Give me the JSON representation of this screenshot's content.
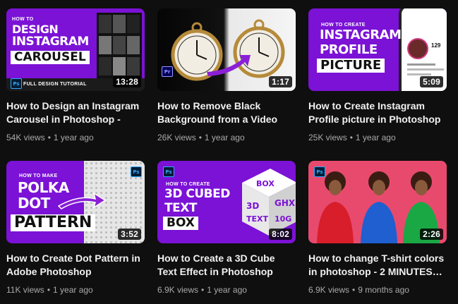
{
  "videos": [
    {
      "title": "How to Design an Instagram Carousel in Photoshop - Full…",
      "views": "54K views",
      "age": "1 year ago",
      "duration": "13:28",
      "thumb": {
        "line1": "HOW TO",
        "line2": "DESIGN",
        "line3": "INSTAGRAM",
        "line4": "CAROUSEL",
        "badge_text": "FULL DESIGN TUTORIAL",
        "app": "Ps"
      }
    },
    {
      "title": "How to Remove Black Background from a Video in…",
      "views": "26K views",
      "age": "1 year ago",
      "duration": "1:17",
      "thumb": {
        "app": "Pr"
      }
    },
    {
      "title": "How to Create Instagram Profile picture in Photoshop",
      "views": "25K views",
      "age": "1 year ago",
      "duration": "5:09",
      "thumb": {
        "line1": "HOW TO CREATE",
        "line2": "INSTAGRAM",
        "line3": "PROFILE",
        "line4": "PICTURE",
        "stat": "129"
      }
    },
    {
      "title": "How to Create Dot Pattern in Adobe Photoshop",
      "views": "11K views",
      "age": "1 year ago",
      "duration": "3:52",
      "thumb": {
        "line1": "HOW TO MAKE",
        "line2": "POLKA",
        "line3": "DOT",
        "line4": "PATTERN",
        "app": "Ps"
      }
    },
    {
      "title": "How to Create a 3D Cube Text Effect in Photoshop",
      "views": "6.9K views",
      "age": "1 year ago",
      "duration": "8:02",
      "thumb": {
        "line1": "HOW TO CREATE",
        "line2": "3D CUBED",
        "line3": "TEXT",
        "line4": "BOX",
        "app": "Ps"
      }
    },
    {
      "title": "How to change T-shirt colors in photoshop - 2 MINUTES…",
      "views": "6.9K views",
      "age": "9 months ago",
      "duration": "2:26",
      "thumb": {
        "app": "Ps"
      }
    }
  ],
  "separator": "•",
  "colors": {
    "background": "#0f0f0f",
    "title": "#f1f1f1",
    "meta": "#aaaaaa",
    "purple": "#7b12d6"
  }
}
